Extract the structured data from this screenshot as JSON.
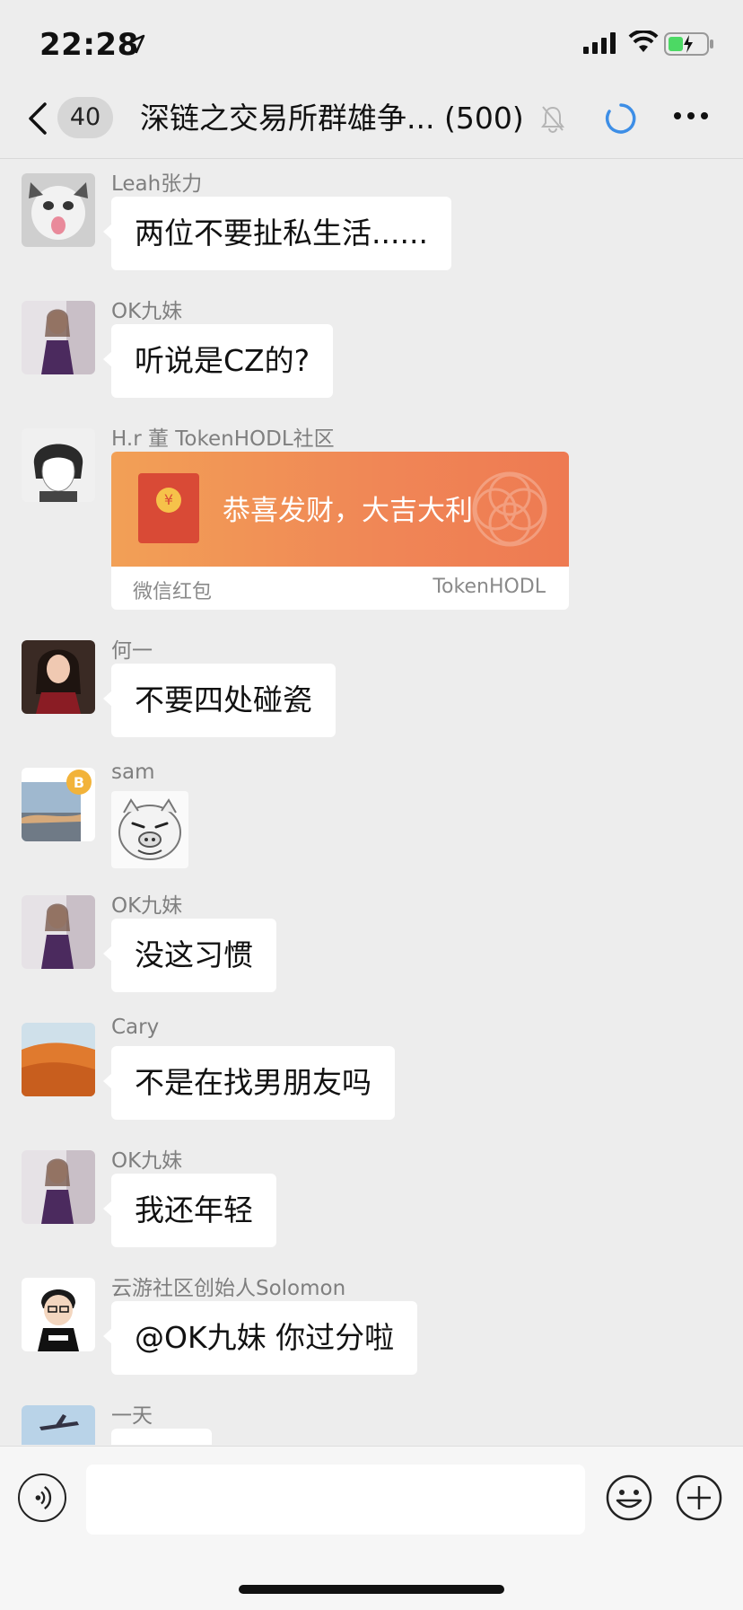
{
  "status": {
    "time": "22:28"
  },
  "nav": {
    "unread_count": "40",
    "title": "深链之交易所群雄争... (500)"
  },
  "messages": [
    {
      "sender": "Leah张力",
      "text": "两位不要扯私生活......"
    },
    {
      "sender": "OK九妹",
      "text": "听说是CZ的?"
    },
    {
      "sender": "H.r 董 TokenHODL社区",
      "red_packet": {
        "greeting": "恭喜发财，大吉大利",
        "label": "微信红包",
        "brand": "TokenHODL"
      }
    },
    {
      "sender": "何一",
      "text": "不要四处碰瓷"
    },
    {
      "sender": "sam",
      "sticker": "laughing-pig-sticker"
    },
    {
      "sender": "OK九妹",
      "text": "没这习惯"
    },
    {
      "sender": "Cary",
      "text": "不是在找男朋友吗"
    },
    {
      "sender": "OK九妹",
      "text": "我还年轻"
    },
    {
      "sender": "云游社区创始人Solomon",
      "text": "@OK九妹 你过分啦"
    },
    {
      "sender": "一天"
    }
  ],
  "input": {
    "value": ""
  },
  "colors": {
    "background": "#ededed",
    "bubble": "#ffffff",
    "red_packet": "#f08656",
    "sender": "#7f7f7f"
  }
}
